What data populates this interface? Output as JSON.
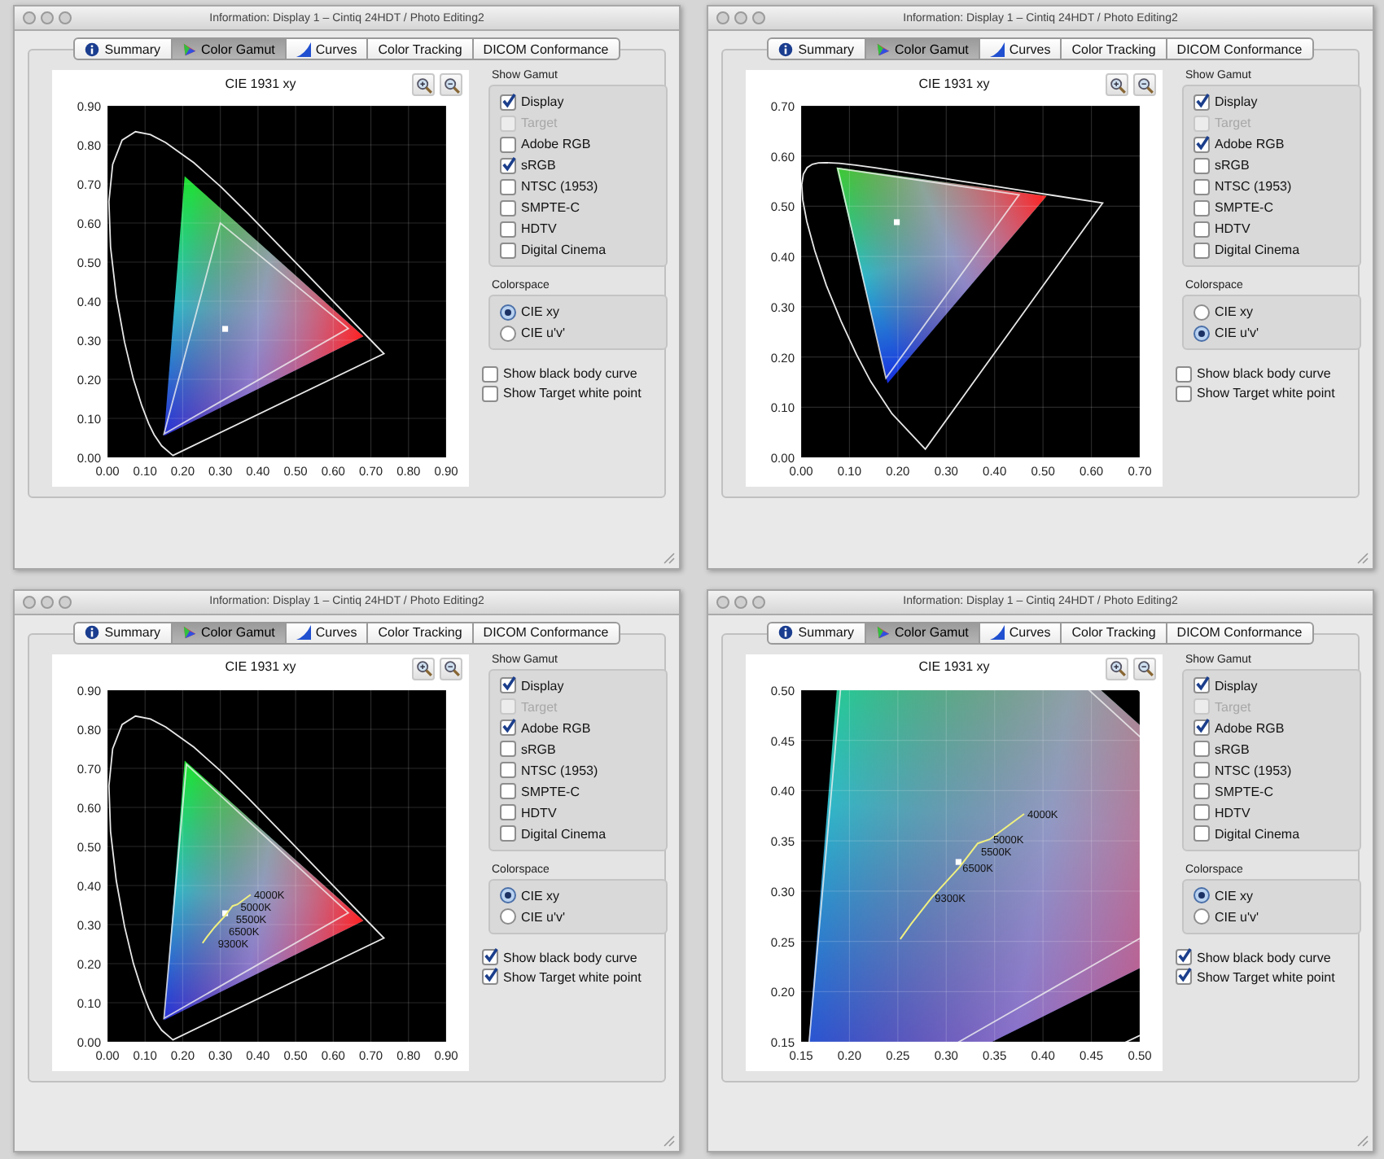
{
  "windows": [
    {
      "title": "Information: Display 1 – Cintiq 24HDT / Photo Editing2",
      "tabs": [
        {
          "label": "Summary",
          "selected": false
        },
        {
          "label": "Color Gamut",
          "selected": true
        },
        {
          "label": "Curves",
          "selected": false
        },
        {
          "label": "Color Tracking",
          "selected": false
        },
        {
          "label": "DICOM Conformance",
          "selected": false
        }
      ],
      "chart": {
        "title": "CIE 1931 xy",
        "xticks": [
          "0.00",
          "0.10",
          "0.20",
          "0.30",
          "0.40",
          "0.50",
          "0.60",
          "0.70",
          "0.80",
          "0.90"
        ],
        "yticks": [
          "0.90",
          "0.80",
          "0.70",
          "0.60",
          "0.50",
          "0.40",
          "0.30",
          "0.20",
          "0.10",
          "0.00"
        ]
      },
      "show_gamut": {
        "label": "Show Gamut",
        "items": [
          {
            "label": "Display",
            "checked": true,
            "disabled": false
          },
          {
            "label": "Target",
            "checked": false,
            "disabled": true
          },
          {
            "label": "Adobe RGB",
            "checked": false,
            "disabled": false
          },
          {
            "label": "sRGB",
            "checked": true,
            "disabled": false
          },
          {
            "label": "NTSC (1953)",
            "checked": false,
            "disabled": false
          },
          {
            "label": "SMPTE-C",
            "checked": false,
            "disabled": false
          },
          {
            "label": "HDTV",
            "checked": false,
            "disabled": false
          },
          {
            "label": "Digital Cinema",
            "checked": false,
            "disabled": false
          }
        ]
      },
      "colorspace": {
        "label": "Colorspace",
        "options": [
          {
            "label": "CIE xy",
            "selected": true
          },
          {
            "label": "CIE u'v'",
            "selected": false
          }
        ]
      },
      "options": [
        {
          "label": "Show black body curve",
          "checked": false
        },
        {
          "label": "Show Target white point",
          "checked": false
        }
      ]
    },
    {
      "title": "Information: Display 1 – Cintiq 24HDT / Photo Editing2",
      "tabs": [
        {
          "label": "Summary",
          "selected": false
        },
        {
          "label": "Color Gamut",
          "selected": true
        },
        {
          "label": "Curves",
          "selected": false
        },
        {
          "label": "Color Tracking",
          "selected": false
        },
        {
          "label": "DICOM Conformance",
          "selected": false
        }
      ],
      "chart": {
        "title": "CIE 1931 xy",
        "xticks": [
          "0.00",
          "0.10",
          "0.20",
          "0.30",
          "0.40",
          "0.50",
          "0.60",
          "0.70"
        ],
        "yticks": [
          "0.70",
          "0.60",
          "0.50",
          "0.40",
          "0.30",
          "0.20",
          "0.10",
          "0.00"
        ]
      },
      "show_gamut": {
        "label": "Show Gamut",
        "items": [
          {
            "label": "Display",
            "checked": true,
            "disabled": false
          },
          {
            "label": "Target",
            "checked": false,
            "disabled": true
          },
          {
            "label": "Adobe RGB",
            "checked": true,
            "disabled": false
          },
          {
            "label": "sRGB",
            "checked": false,
            "disabled": false
          },
          {
            "label": "NTSC (1953)",
            "checked": false,
            "disabled": false
          },
          {
            "label": "SMPTE-C",
            "checked": false,
            "disabled": false
          },
          {
            "label": "HDTV",
            "checked": false,
            "disabled": false
          },
          {
            "label": "Digital Cinema",
            "checked": false,
            "disabled": false
          }
        ]
      },
      "colorspace": {
        "label": "Colorspace",
        "options": [
          {
            "label": "CIE xy",
            "selected": false
          },
          {
            "label": "CIE u'v'",
            "selected": true
          }
        ]
      },
      "options": [
        {
          "label": "Show black body curve",
          "checked": false
        },
        {
          "label": "Show Target white point",
          "checked": false
        }
      ]
    },
    {
      "title": "Information: Display 1 – Cintiq 24HDT / Photo Editing2",
      "tabs": [
        {
          "label": "Summary",
          "selected": false
        },
        {
          "label": "Color Gamut",
          "selected": true
        },
        {
          "label": "Curves",
          "selected": false
        },
        {
          "label": "Color Tracking",
          "selected": false
        },
        {
          "label": "DICOM Conformance",
          "selected": false
        }
      ],
      "chart": {
        "title": "CIE 1931 xy",
        "xticks": [
          "0.00",
          "0.10",
          "0.20",
          "0.30",
          "0.40",
          "0.50",
          "0.60",
          "0.70",
          "0.80",
          "0.90"
        ],
        "yticks": [
          "0.90",
          "0.80",
          "0.70",
          "0.60",
          "0.50",
          "0.40",
          "0.30",
          "0.20",
          "0.10",
          "0.00"
        ],
        "temperature_labels": [
          "4000K",
          "5000K",
          "5500K",
          "6500K",
          "9300K"
        ]
      },
      "show_gamut": {
        "label": "Show Gamut",
        "items": [
          {
            "label": "Display",
            "checked": true,
            "disabled": false
          },
          {
            "label": "Target",
            "checked": false,
            "disabled": true
          },
          {
            "label": "Adobe RGB",
            "checked": true,
            "disabled": false
          },
          {
            "label": "sRGB",
            "checked": false,
            "disabled": false
          },
          {
            "label": "NTSC (1953)",
            "checked": false,
            "disabled": false
          },
          {
            "label": "SMPTE-C",
            "checked": false,
            "disabled": false
          },
          {
            "label": "HDTV",
            "checked": false,
            "disabled": false
          },
          {
            "label": "Digital Cinema",
            "checked": false,
            "disabled": false
          }
        ]
      },
      "colorspace": {
        "label": "Colorspace",
        "options": [
          {
            "label": "CIE xy",
            "selected": true
          },
          {
            "label": "CIE u'v'",
            "selected": false
          }
        ]
      },
      "options": [
        {
          "label": "Show black body curve",
          "checked": true
        },
        {
          "label": "Show Target white point",
          "checked": true
        }
      ]
    },
    {
      "title": "Information: Display 1 – Cintiq 24HDT / Photo Editing2",
      "tabs": [
        {
          "label": "Summary",
          "selected": false
        },
        {
          "label": "Color Gamut",
          "selected": true
        },
        {
          "label": "Curves",
          "selected": false
        },
        {
          "label": "Color Tracking",
          "selected": false
        },
        {
          "label": "DICOM Conformance",
          "selected": false
        }
      ],
      "chart": {
        "title": "CIE 1931 xy",
        "xticks": [
          "0.15",
          "0.20",
          "0.25",
          "0.30",
          "0.35",
          "0.40",
          "0.45",
          "0.50"
        ],
        "yticks": [
          "0.50",
          "0.45",
          "0.40",
          "0.35",
          "0.30",
          "0.25",
          "0.20",
          "0.15"
        ],
        "temperature_labels": [
          "4000K",
          "5000K",
          "5500K",
          "6500K",
          "9300K"
        ]
      },
      "show_gamut": {
        "label": "Show Gamut",
        "items": [
          {
            "label": "Display",
            "checked": true,
            "disabled": false
          },
          {
            "label": "Target",
            "checked": false,
            "disabled": true
          },
          {
            "label": "Adobe RGB",
            "checked": true,
            "disabled": false
          },
          {
            "label": "sRGB",
            "checked": false,
            "disabled": false
          },
          {
            "label": "NTSC (1953)",
            "checked": false,
            "disabled": false
          },
          {
            "label": "SMPTE-C",
            "checked": false,
            "disabled": false
          },
          {
            "label": "HDTV",
            "checked": false,
            "disabled": false
          },
          {
            "label": "Digital Cinema",
            "checked": false,
            "disabled": false
          }
        ]
      },
      "colorspace": {
        "label": "Colorspace",
        "options": [
          {
            "label": "CIE xy",
            "selected": true
          },
          {
            "label": "CIE u'v'",
            "selected": false
          }
        ]
      },
      "options": [
        {
          "label": "Show black body curve",
          "checked": true
        },
        {
          "label": "Show Target white point",
          "checked": true
        }
      ]
    }
  ]
}
